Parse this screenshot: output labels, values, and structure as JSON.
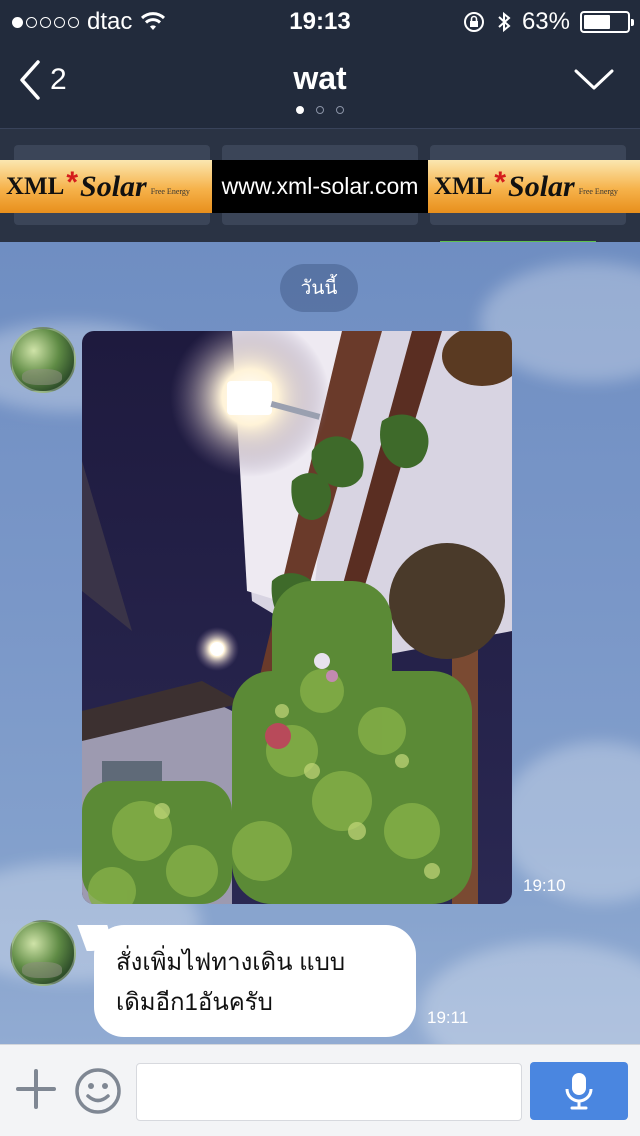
{
  "status_bar": {
    "signal_dots_filled": 1,
    "signal_dots_total": 5,
    "carrier": "dtac",
    "time": "19:13",
    "battery": "63%",
    "battery_level": 0.63
  },
  "nav": {
    "back_count": "2",
    "title": "wat",
    "pager_total": 3,
    "pager_active": 0
  },
  "banner": {
    "logo_text": "XML",
    "logo_star": "*",
    "logo_brand": "Solar",
    "logo_tagline": "Free Energy",
    "url": "www.xml-solar.com"
  },
  "chat": {
    "date_label": "วันนี้",
    "messages": [
      {
        "type": "image",
        "time": "19:10"
      },
      {
        "type": "text",
        "text_line1": "สั่งเพิ่มไฟทางเดิน แบบ",
        "text_line2": "เดิมอีก1อันครับ",
        "time": "19:11"
      }
    ]
  },
  "input": {
    "placeholder": ""
  },
  "colors": {
    "header_bg": "#222b3c",
    "chat_bg": "#7a97c8",
    "mic_button": "#4a86e0"
  },
  "icons": {
    "back": "chevron-left-icon",
    "menu": "chevron-down-icon",
    "add": "plus-icon",
    "emoji": "smiley-icon",
    "mic": "microphone-icon"
  }
}
